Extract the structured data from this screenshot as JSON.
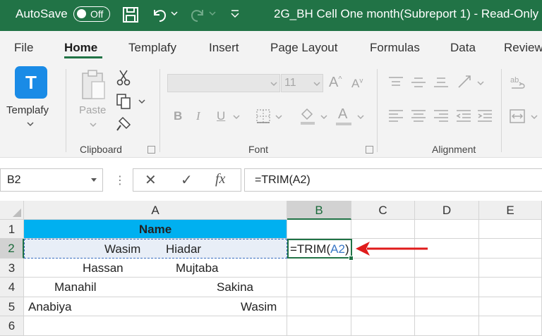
{
  "titlebar": {
    "autosave_label": "AutoSave",
    "autosave_state": "Off",
    "document_title": "2G_BH Cell One month(Subreport 1)  -  Read-Only"
  },
  "tabs": [
    "File",
    "Home",
    "Templafy",
    "Insert",
    "Page Layout",
    "Formulas",
    "Data",
    "Review"
  ],
  "active_tab": "Home",
  "ribbon": {
    "templafy_label": "Templafy",
    "templafy_logo": "T",
    "paste_label": "Paste",
    "clipboard_label": "Clipboard",
    "font_size": "11",
    "font_label": "Font",
    "alignment_label": "Alignment",
    "bold": "B",
    "italic": "I",
    "underline": "U",
    "font_color_glyph": "A"
  },
  "formula_bar": {
    "name_box": "B2",
    "cancel_glyph": "✕",
    "enter_glyph": "✓",
    "fx_glyph": "fx",
    "formula": "=TRIM(A2)"
  },
  "grid": {
    "columns": [
      "A",
      "B",
      "C",
      "D",
      "E"
    ],
    "rows": [
      "1",
      "2",
      "3",
      "4",
      "5",
      "6"
    ],
    "header_cell": "Name",
    "data": {
      "r2": [
        "Wasim",
        "Hiadar"
      ],
      "r3": [
        "Hassan",
        "Mujtaba"
      ],
      "r4": [
        "Manahil",
        "Sakina"
      ],
      "r5": [
        "Anabiya",
        "Wasim"
      ]
    },
    "active_cell": {
      "prefix": "=TRIM(",
      "ref": "A2",
      "suffix": ")"
    }
  },
  "colors": {
    "excel_green": "#217346",
    "header_fill": "#00b0f0",
    "arrow": "#e01b1b",
    "reference_blue": "#3a78c6"
  }
}
